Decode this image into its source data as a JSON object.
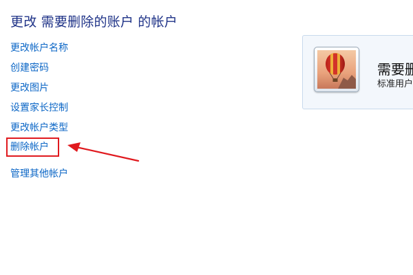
{
  "header": {
    "title": "更改 需要删除的账户 的帐户"
  },
  "tasks": [
    {
      "label": "更改帐户名称"
    },
    {
      "label": "创建密码"
    },
    {
      "label": "更改图片"
    },
    {
      "label": "设置家长控制"
    },
    {
      "label": "更改帐户类型"
    },
    {
      "label": "删除帐户"
    },
    {
      "label": "管理其他帐户"
    }
  ],
  "account": {
    "name": "需要删",
    "type": "标准用户",
    "avatar_icon": "hot-air-balloon-picture"
  },
  "annotation": {
    "highlight_color": "#e0191e",
    "arrow_color": "#e0191e"
  }
}
